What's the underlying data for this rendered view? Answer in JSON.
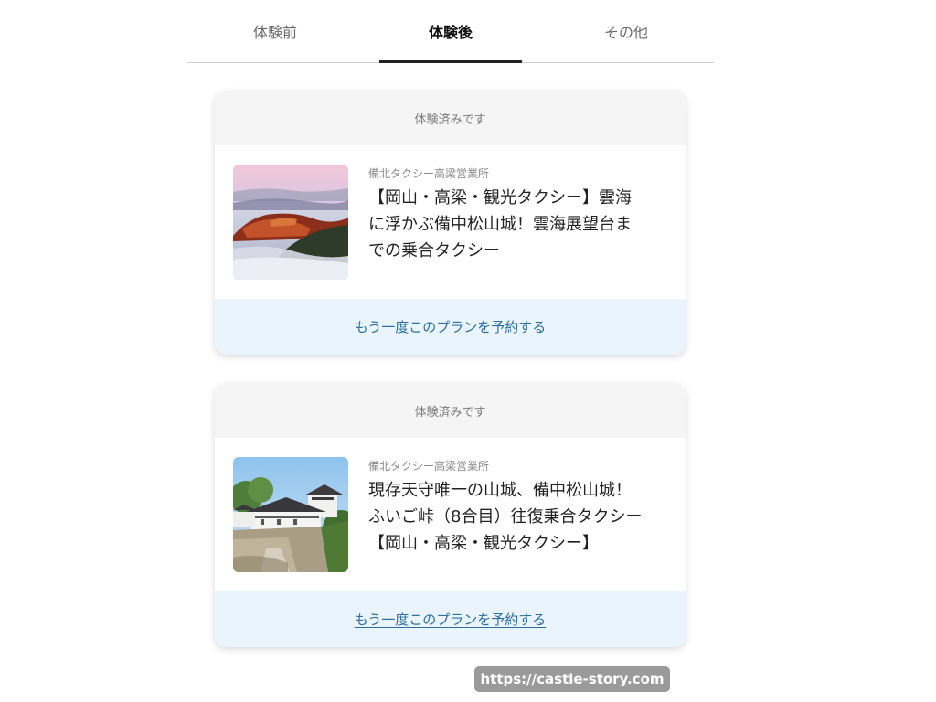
{
  "tabs": [
    {
      "label": "体験前",
      "active": false
    },
    {
      "label": "体験後",
      "active": true
    },
    {
      "label": "その他",
      "active": false
    }
  ],
  "cards": [
    {
      "status": "体験済みです",
      "provider": "備北タクシー高梁営業所",
      "title_lines": [
        "【岡山・高梁・観光タクシー】雲海",
        "に浮かぶ備中松山城！雲海展望台ま",
        "での乗合タクシー"
      ],
      "image": "sea-of-clouds-castle-photo",
      "action_label": "もう一度このプランを予約する"
    },
    {
      "status": "体験済みです",
      "provider": "備北タクシー高梁営業所",
      "title_lines": [
        "現存天守唯一の山城、備中松山城！",
        "ふいご峠（8合目）往復乗合タクシー",
        "【岡山・高梁・観光タクシー】"
      ],
      "image": "castle-wall-photo",
      "action_label": "もう一度このプランを予約する"
    }
  ],
  "watermark": "https://castle-story.com",
  "colors": {
    "tab_active_underline": "#222222",
    "status_bg": "#f5f5f5",
    "action_bg": "#eaf4fc",
    "link": "#2c6fa0"
  }
}
